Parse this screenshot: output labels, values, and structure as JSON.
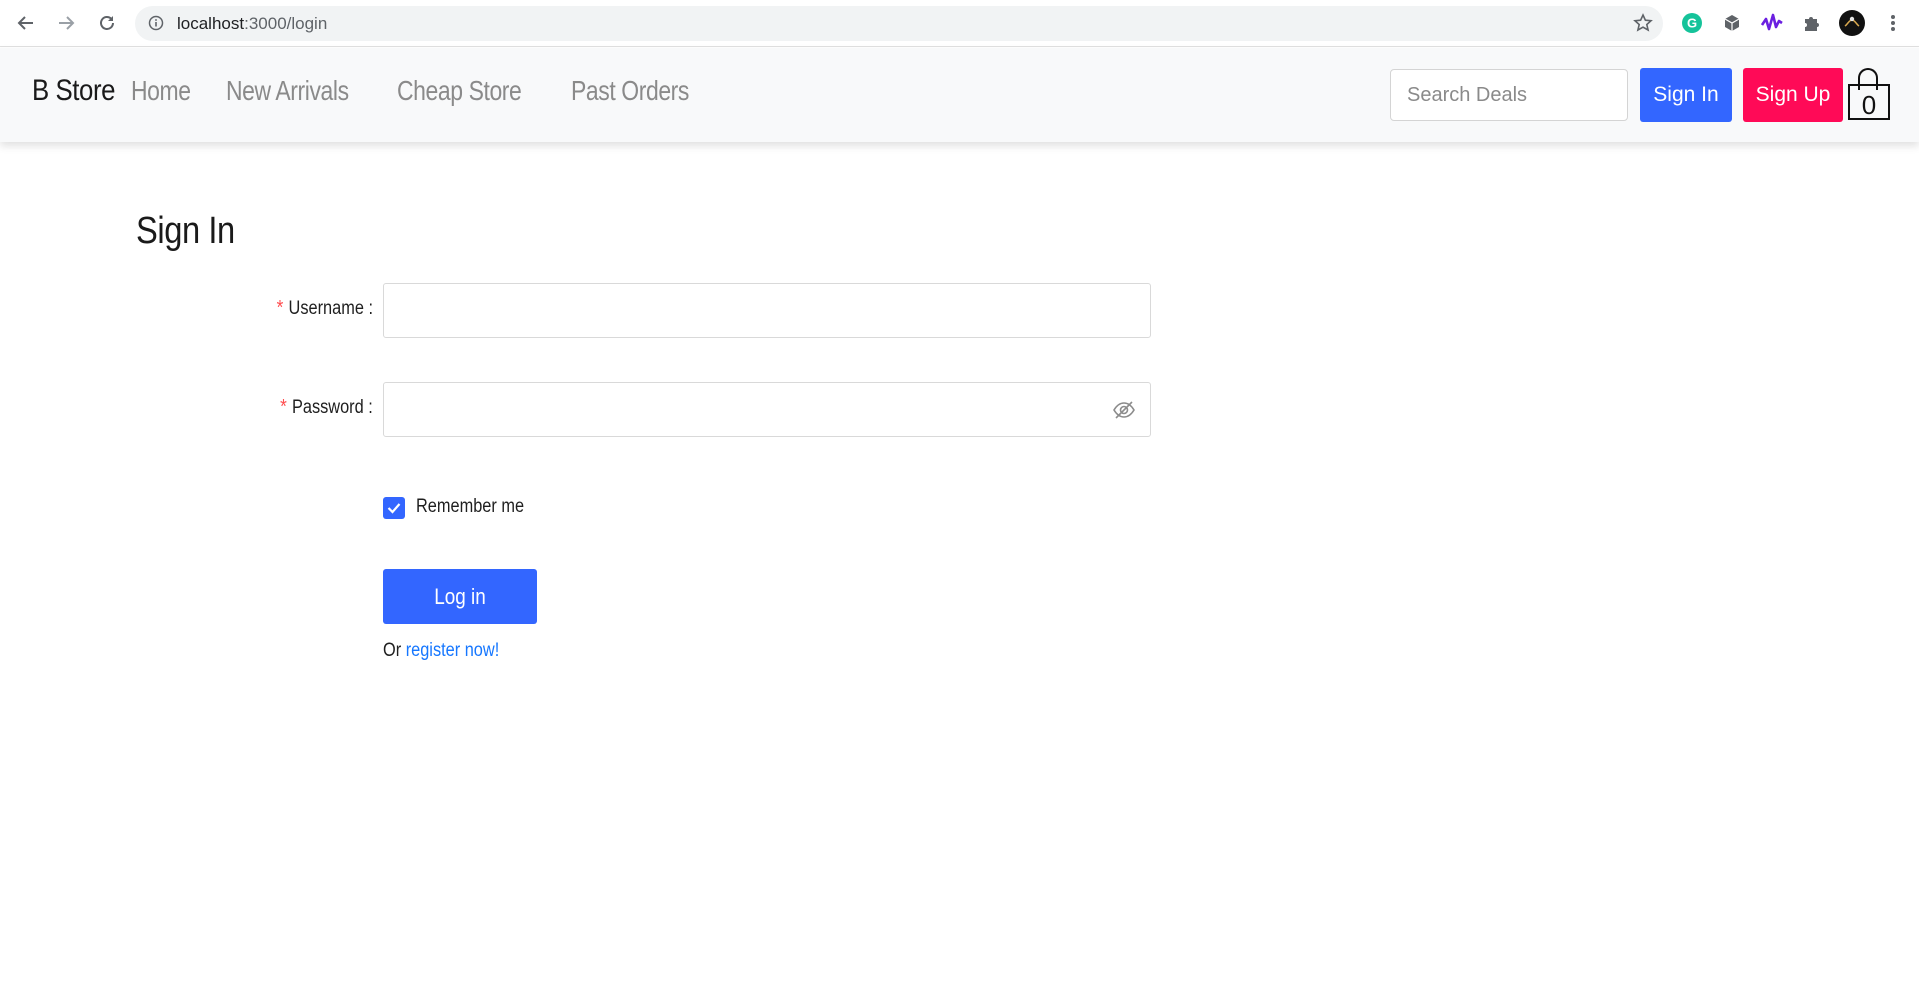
{
  "browser": {
    "url_host": "localhost",
    "url_path": ":3000/login",
    "icons": [
      "back-arrow-icon",
      "forward-arrow-icon",
      "reload-icon",
      "site-info-icon",
      "bookmark-star-icon",
      "grammarly-extension-icon",
      "cube-extension-icon",
      "wave-extension-icon",
      "puzzle-extensions-icon",
      "profile-avatar",
      "more-menu-icon"
    ]
  },
  "navbar": {
    "brand": "B Store",
    "links": [
      "Home",
      "New Arrivals",
      "Cheap Store",
      "Past Orders"
    ],
    "search_placeholder": "Search Deals",
    "signin_label": "Sign In",
    "signup_label": "Sign Up",
    "cart_count": "0",
    "colors": {
      "signin": "#3366ff",
      "signup": "#ff0a57",
      "navbar_bg": "#f8f9fa"
    }
  },
  "form": {
    "title": "Sign In",
    "username_label": "Username :",
    "password_label": "Password :",
    "required_mark": "*",
    "username_value": "",
    "password_value": "",
    "remember_label": "Remember me",
    "remember_checked": true,
    "login_label": "Log in",
    "register_prefix": "Or",
    "register_link": "register now!",
    "colors": {
      "primary": "#3366ff",
      "required": "#ff4d4f",
      "link": "#1677ff"
    }
  }
}
